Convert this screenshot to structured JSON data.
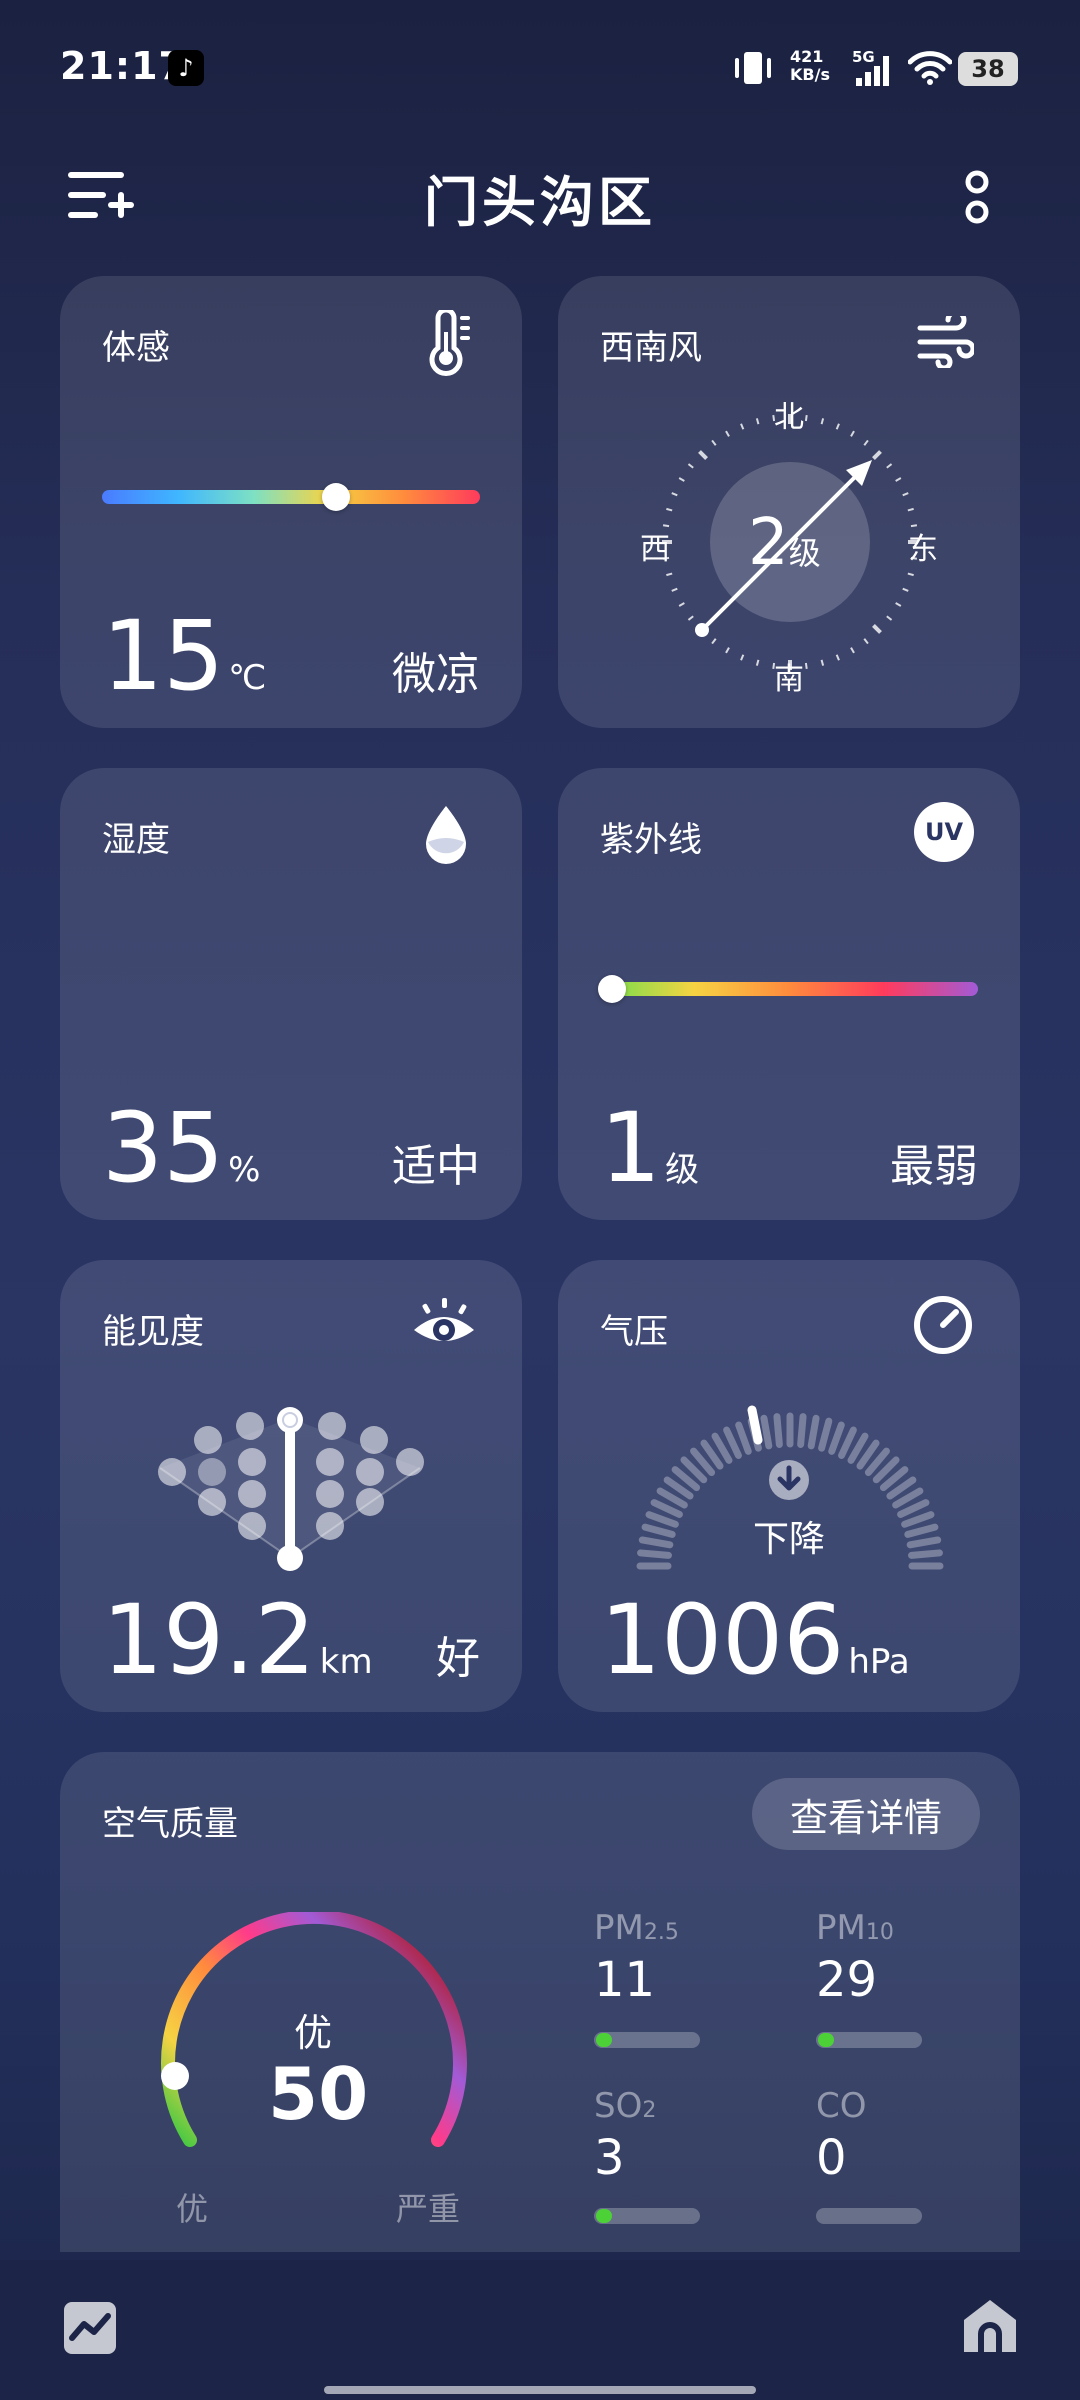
{
  "status_bar": {
    "time": "21:17",
    "net_speed_value": "421",
    "net_speed_unit": "KB/s",
    "network": "5G",
    "battery": "38"
  },
  "header": {
    "title": "门头沟区"
  },
  "feels_like": {
    "title": "体感",
    "value": "15",
    "unit": "℃",
    "desc": "微凉",
    "level": 0.62
  },
  "wind": {
    "title": "西南风",
    "level": "2",
    "level_unit": "级",
    "dir_n": "北",
    "dir_s": "南",
    "dir_e": "东",
    "dir_w": "西"
  },
  "humidity": {
    "title": "湿度",
    "value": "35",
    "unit": "%",
    "desc": "适中"
  },
  "uv": {
    "title": "紫外线",
    "value": "1",
    "unit": "级",
    "desc": "最弱",
    "icon_text": "UV",
    "level": 0.0
  },
  "visibility": {
    "title": "能见度",
    "value": "19.2",
    "unit": "km",
    "desc": "好"
  },
  "pressure": {
    "title": "气压",
    "value": "1006",
    "unit": "hPa",
    "trend": "下降"
  },
  "air_quality": {
    "title": "空气质量",
    "details_label": "查看详情",
    "aqi_value": "50",
    "aqi_level": "优",
    "scale_min_label": "优",
    "scale_max_label": "严重",
    "pollutants": [
      {
        "name": "PM",
        "sub": "2.5",
        "value": "11",
        "level": 0.05
      },
      {
        "name": "PM",
        "sub": "10",
        "value": "29",
        "level": 0.05
      },
      {
        "name": "SO",
        "sub": "2",
        "value": "3",
        "level": 0.05
      },
      {
        "name": "CO",
        "sub": "",
        "value": "0",
        "level": 0.0
      }
    ]
  },
  "colors": {
    "good": "#4cd137",
    "card_bg": "rgba(255,255,255,0.11)"
  }
}
